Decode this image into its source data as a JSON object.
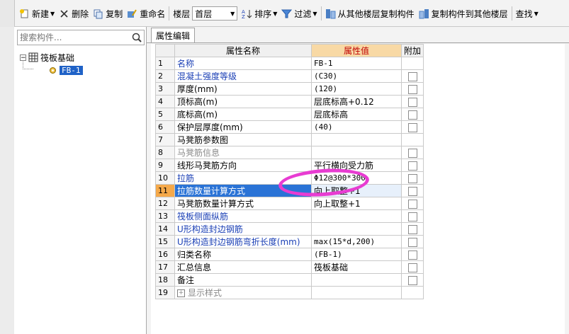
{
  "toolbar": {
    "new_label": "新建",
    "delete_label": "删除",
    "copy_label": "复制",
    "rename_label": "重命名",
    "floor_label": "楼层",
    "floor_value": "首层",
    "sort_label": "排序",
    "filter_label": "过滤",
    "copy_from_other_label": "从其他楼层复制构件",
    "copy_to_other_label": "复制构件到其他楼层",
    "find_label": "查找"
  },
  "left": {
    "search_placeholder": "搜索构件...",
    "tree_root": "筏板基础",
    "tree_child": "FB-1"
  },
  "tab_label": "属性编辑",
  "grid": {
    "headers": {
      "name": "属性名称",
      "value": "属性值",
      "extra": "附加"
    },
    "rows": [
      {
        "n": "1",
        "name": "名称",
        "value": "FB-1",
        "style": "blue",
        "chk": false
      },
      {
        "n": "2",
        "name": "混凝土强度等级",
        "value": "(C30)",
        "style": "blue",
        "chk": true
      },
      {
        "n": "3",
        "name": "厚度(mm)",
        "value": "(120)",
        "style": "",
        "chk": true
      },
      {
        "n": "4",
        "name": "顶标高(m)",
        "value": "层底标高+0.12",
        "style": "",
        "chk": true
      },
      {
        "n": "5",
        "name": "底标高(m)",
        "value": "层底标高",
        "style": "",
        "chk": true
      },
      {
        "n": "6",
        "name": "保护层厚度(mm)",
        "value": "(40)",
        "style": "",
        "chk": true
      },
      {
        "n": "7",
        "name": "马凳筋参数图",
        "value": "",
        "style": "",
        "chk": false
      },
      {
        "n": "8",
        "name": "马凳筋信息",
        "value": "",
        "style": "gray",
        "chk": true
      },
      {
        "n": "9",
        "name": "线形马凳筋方向",
        "value": "平行横向受力筋",
        "style": "",
        "chk": true
      },
      {
        "n": "10",
        "name": "拉筋",
        "value": "Φ12@300*300",
        "style": "blue",
        "chk": true
      },
      {
        "n": "11",
        "name": "拉筋数量计算方式",
        "value": "向上取整+1",
        "style": "",
        "chk": true,
        "selected": true
      },
      {
        "n": "12",
        "name": "马凳筋数量计算方式",
        "value": "向上取整+1",
        "style": "",
        "chk": true
      },
      {
        "n": "13",
        "name": "筏板侧面纵筋",
        "value": "",
        "style": "blue",
        "chk": true
      },
      {
        "n": "14",
        "name": "U形构造封边钢筋",
        "value": "",
        "style": "blue",
        "chk": true
      },
      {
        "n": "15",
        "name": "U形构造封边钢筋弯折长度(mm)",
        "value": "max(15*d,200)",
        "style": "blue",
        "chk": true
      },
      {
        "n": "16",
        "name": "归类名称",
        "value": "(FB-1)",
        "style": "",
        "chk": true
      },
      {
        "n": "17",
        "name": "汇总信息",
        "value": "筏板基础",
        "style": "",
        "chk": true
      },
      {
        "n": "18",
        "name": "备注",
        "value": "",
        "style": "",
        "chk": true
      },
      {
        "n": "19",
        "name": "显示样式",
        "value": "",
        "style": "gray",
        "chk": false,
        "expand": true
      }
    ]
  }
}
